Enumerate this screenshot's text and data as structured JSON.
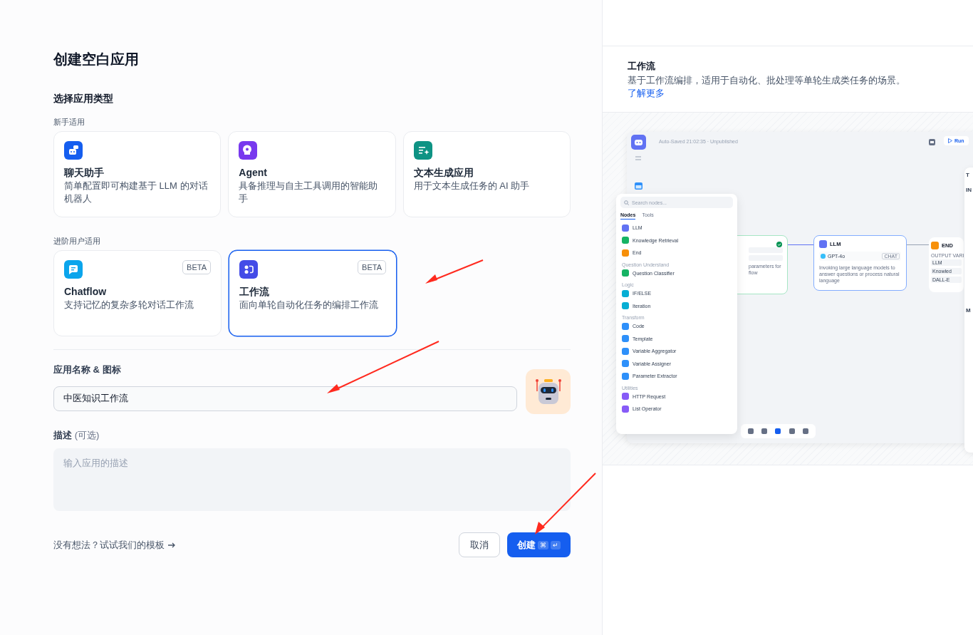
{
  "form": {
    "title": "创建空白应用",
    "type_heading": "选择应用类型",
    "groups": [
      {
        "label": "新手适用",
        "apps": [
          {
            "kind": "chat",
            "name": "聊天助手",
            "description": "简单配置即可构建基于 LLM 的对话机器人",
            "color": "#155eef",
            "selected": false
          },
          {
            "kind": "agent",
            "name": "Agent",
            "description": "具备推理与自主工具调用的智能助手",
            "color": "#7839ee",
            "selected": false
          },
          {
            "kind": "text",
            "name": "文本生成应用",
            "description": "用于文本生成任务的 AI 助手",
            "color": "#0e9384",
            "selected": false
          }
        ]
      },
      {
        "label": "进阶用户适用",
        "apps": [
          {
            "kind": "chatflow",
            "name": "Chatflow",
            "description": "支持记忆的复杂多轮对话工作流",
            "color": "#0ba5ec",
            "badge": "BETA",
            "selected": false
          },
          {
            "kind": "workflow",
            "name": "工作流",
            "description": "面向单轮自动化任务的编排工作流",
            "color": "#444ce7",
            "badge": "BETA",
            "selected": true
          }
        ]
      }
    ],
    "name_field": {
      "label": "应用名称 & 图标",
      "value": "中医知识工作流"
    },
    "description_field": {
      "label": "描述",
      "optional": "(可选)",
      "placeholder": "输入应用的描述"
    },
    "template_link": "没有想法？试试我们的模板",
    "cancel_button": "取消",
    "create_button": {
      "label": "创建",
      "keys": [
        "⌘",
        "↵"
      ]
    }
  },
  "info": {
    "title": "工作流",
    "description": "基于工作流编排，适用于自动化、批处理等单轮生成类任务的场景。",
    "link": "了解更多"
  },
  "preview": {
    "status": "Auto-Saved 21:02:35 · Unpublished",
    "run_button": "Run",
    "search_placeholder": "Search nodes...",
    "tabs": [
      {
        "label": "Nodes",
        "selected": true
      },
      {
        "label": "Tools",
        "selected": false
      }
    ],
    "node_groups": [
      {
        "items": [
          {
            "label": "LLM",
            "color": "#6172f3"
          },
          {
            "label": "Knowledge Retrieval",
            "color": "#16b364"
          },
          {
            "label": "End",
            "color": "#f79009"
          }
        ]
      },
      {
        "heading": "Question Understand",
        "items": [
          {
            "label": "Question Classifier",
            "color": "#16b364"
          }
        ]
      },
      {
        "heading": "Logic",
        "items": [
          {
            "label": "IF/ELSE",
            "color": "#06aed4"
          },
          {
            "label": "Iteration",
            "color": "#06aed4"
          }
        ]
      },
      {
        "heading": "Transform",
        "items": [
          {
            "label": "Code",
            "color": "#2e90fa"
          },
          {
            "label": "Template",
            "color": "#2e90fa"
          },
          {
            "label": "Variable Aggregator",
            "color": "#2e90fa"
          },
          {
            "label": "Variable Assigner",
            "color": "#2e90fa"
          },
          {
            "label": "Parameter Extractor",
            "color": "#2e90fa"
          }
        ]
      },
      {
        "heading": "Utilities",
        "items": [
          {
            "label": "HTTP Request",
            "color": "#875bf7"
          },
          {
            "label": "List Operator",
            "color": "#875bf7"
          }
        ]
      }
    ],
    "start_node": {
      "lines": [
        "parameters for",
        "flow"
      ]
    },
    "llm_node": {
      "title": "LLM",
      "model": "GPT-4o",
      "tag": "CHAT",
      "description": "Invoking large language models to answer questions or process natural language"
    },
    "end_node": {
      "title": "END",
      "heading": "OUTPUT VARI",
      "outputs": [
        "LLM",
        "Knowled",
        "DALL-E"
      ]
    },
    "side_panel": {
      "letters": [
        "T",
        "IN",
        "M"
      ]
    }
  }
}
